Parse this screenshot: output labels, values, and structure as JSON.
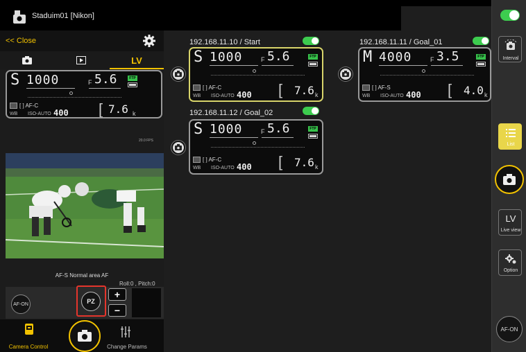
{
  "app": {
    "title": "Staduim01 [Nikon]"
  },
  "left_panel": {
    "close_label": "<< Close",
    "tabs": [
      {
        "name": "photo"
      },
      {
        "name": "playback"
      },
      {
        "label": "LV",
        "active": true
      }
    ],
    "lcd": {
      "mode": "S",
      "shutter": "1000",
      "f_prefix": "F",
      "aperture": "5.6",
      "ftp": "FTP",
      "af_area": "[ ] AF-C",
      "wb": "WB",
      "iso_prefix": "ISO-AUTO",
      "iso": "400",
      "shots": "7.6",
      "shots_unit": "k"
    },
    "fps": "20.0 FPS",
    "af_status": "AF-S  Normal area AF",
    "roll_pitch": "Roll:0 , Pitch:0",
    "afon_label": "AF-ON",
    "pz_label": "PZ",
    "plus": "+",
    "minus": "−",
    "bottom": {
      "camera_control": "Camera Control",
      "change_params": "Change Params"
    }
  },
  "cameras": [
    {
      "header": "192.168.11.10 / Start",
      "selected": true,
      "enabled": true,
      "mode": "S",
      "shutter": "1000",
      "f_prefix": "F",
      "aperture": "5.6",
      "ftp": "FTP",
      "af_area": "[ ] AF-C",
      "wb": "WB",
      "iso_prefix": "ISO-AUTO",
      "iso": "400",
      "shots": "7.6",
      "shots_unit": "k"
    },
    {
      "header": "192.168.11.11 / Goal_01",
      "selected": false,
      "enabled": true,
      "mode": "M",
      "shutter": "4000",
      "f_prefix": "F",
      "aperture": "3.5",
      "ftp": "FTP",
      "af_area": "[ ] AF-S",
      "wb": "WB",
      "iso_prefix": "ISO-AUTO",
      "iso": "400",
      "shots": "4.0",
      "shots_unit": "k"
    },
    {
      "header": "192.168.11.12 / Goal_02",
      "selected": false,
      "enabled": true,
      "mode": "S",
      "shutter": "1000",
      "f_prefix": "F",
      "aperture": "5.6",
      "ftp": "FTP",
      "af_area": "[ ] AF-C",
      "wb": "WB",
      "iso_prefix": "ISO-AUTO",
      "iso": "400",
      "shots": "7.6",
      "shots_unit": "k"
    }
  ],
  "right_toolbar": {
    "interval": "Interval",
    "list": "List",
    "liveview_big": "LV",
    "liveview": "Live view",
    "option": "Option",
    "afon": "AF-ON"
  },
  "colors": {
    "accent": "#f2c200",
    "toggle_on": "#3dcc4f",
    "selected_border": "#d9d56b",
    "highlight": "#e5352c"
  }
}
